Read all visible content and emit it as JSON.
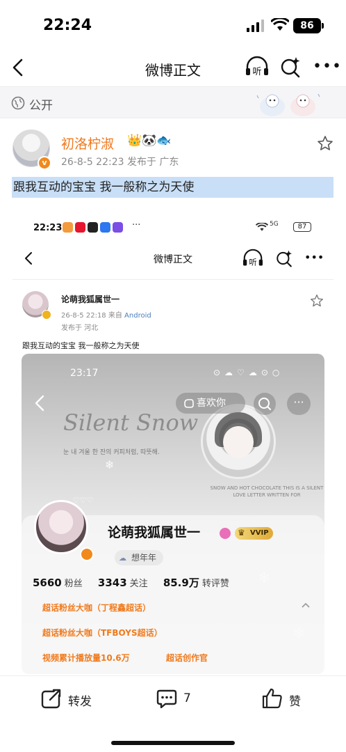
{
  "status_bar": {
    "time": "22:24",
    "battery": "86"
  },
  "nav": {
    "title": "微博正文",
    "listen_label": "听"
  },
  "visibility": {
    "label": "公开"
  },
  "post": {
    "author": "初洛柠淑",
    "author_emojis": "👑🐼🐟",
    "meta": "26-8-5 22:23  发布于 广东",
    "text": "跟我互动的宝宝 我一般称之为天使"
  },
  "embedded": {
    "status_time": "22:23",
    "status_dots": "···",
    "network": "5G",
    "battery": "87",
    "nav_title": "微博正文",
    "listen_label": "听",
    "author": "论萌我狐属世一",
    "meta_time": "26-8-5 22:18",
    "meta_from": "来自",
    "meta_client": "Android",
    "meta_location": "发布于 河北",
    "text": "跟我互动的宝宝 我一般称之为天使",
    "profile": {
      "time": "23:17",
      "like_label": "喜欢你",
      "more_label": "···",
      "bg_script": "Silent Snow",
      "bg_korean": "눈 내 겨울 한 잔의 커피처럼, 따뜻해.",
      "bg_english": "SNOW AND HOT CHOCOLATE THIS IS A SILENT LOVE LETTER WRITTEN FOR",
      "name": "论萌我狐属世一",
      "vvip": "VVIP",
      "year_label": "想年年",
      "fans_count": "5660",
      "fans_label": "粉丝",
      "following_count": "3343",
      "following_label": "关注",
      "likes_count": "85.9万",
      "likes_label": "转评赞",
      "tag1": "超话粉丝大咖（丁程鑫超话）",
      "tag2": "超话粉丝大咖（TFBOYS超话）",
      "tag3": "视频累计播放量10.6万",
      "tag4": "超话创作官"
    }
  },
  "actions": {
    "repost": "转发",
    "comment_count": "7",
    "like": "赞"
  },
  "colors": {
    "accent_orange": "#f0781d",
    "highlight_blue": "#c8dff7",
    "vvip_gold": "#e0a938"
  }
}
